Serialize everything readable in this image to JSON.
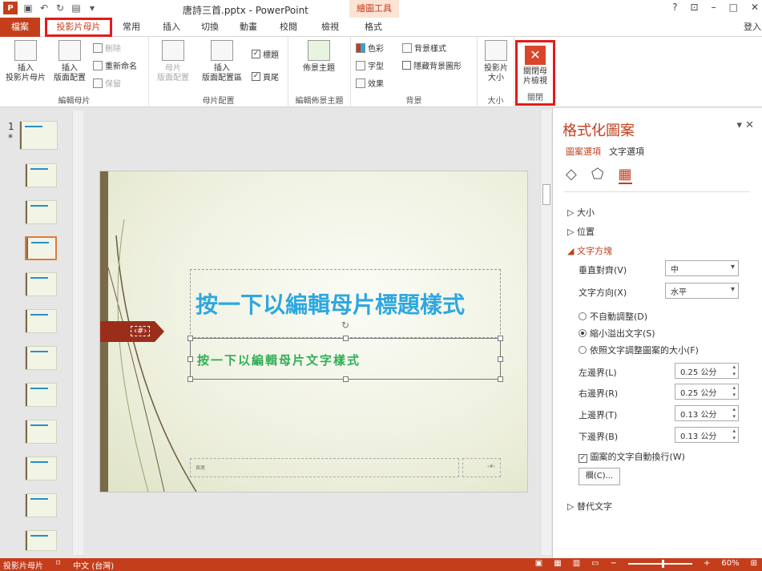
{
  "titlebar": {
    "doc_title": "唐詩三首.pptx - PowerPoint",
    "context_tool": "繪圖工具",
    "win_help": "?",
    "win_login": "登入"
  },
  "tabs": [
    "檔案",
    "投影片母片",
    "常用",
    "插入",
    "切換",
    "動畫",
    "校閱",
    "檢視",
    "格式"
  ],
  "ribbon": {
    "edit_master": {
      "label": "編輯母片",
      "insert_master": "插入\n投影片母片",
      "insert_layout": "插入\n版面配置",
      "delete": "刪除",
      "rename": "重新命名",
      "preserve": "保留"
    },
    "master_layout": {
      "label": "母片配置",
      "master": "母片\n版面配置",
      "insert_placeholder": "插入\n版面配置區",
      "title": "標題",
      "footer": "頁尾"
    },
    "edit_theme": {
      "label": "編輯佈景主題",
      "themes": "佈景主題"
    },
    "background": {
      "label": "背景",
      "colors": "色彩",
      "fonts": "字型",
      "effects": "效果",
      "bg_styles": "背景樣式",
      "hide_bg": "隱藏背景圖形"
    },
    "size": {
      "label": "大小",
      "slide_size": "投影片\n大小"
    },
    "close": {
      "label": "關閉",
      "close_master": "關閉母\n片檢視"
    }
  },
  "slides": {
    "first_number": "1",
    "first_star": "*"
  },
  "slide": {
    "tag_text": "‹#›",
    "title": "按一下以編輯母片標題樣式",
    "body": "按一下以編輯母片文字樣式",
    "footer": "頁尾",
    "number": "‹#›"
  },
  "pane": {
    "title": "格式化圖案",
    "tab_shape": "圖案選項",
    "tab_text": "文字選項",
    "sec_size": "大小",
    "sec_position": "位置",
    "sec_textbox": "文字方塊",
    "valign_label": "垂直對齊(V)",
    "valign_value": "中",
    "direction_label": "文字方向(X)",
    "direction_value": "水平",
    "autofit_none": "不自動調整(D)",
    "autofit_shrink": "縮小溢出文字(S)",
    "autofit_resize": "依照文字調整圖案的大小(F)",
    "left_margin_label": "左邊界(L)",
    "left_margin": "0.25 公分",
    "right_margin_label": "右邊界(R)",
    "right_margin": "0.25 公分",
    "top_margin_label": "上邊界(T)",
    "top_margin": "0.13 公分",
    "bottom_margin_label": "下邊界(B)",
    "bottom_margin": "0.13 公分",
    "wrap_label": "圖案的文字自動換行(W)",
    "columns_button": "欄(C)...",
    "sec_alt": "替代文字"
  },
  "status": {
    "view": "投影片母片",
    "lang": "中文 (台灣)",
    "zoom": "60%"
  },
  "colors": {
    "accent": "#c43e1c",
    "highlight": "#e31b1b",
    "title_blue": "#2ea7e0",
    "body_green": "#2fae55"
  }
}
